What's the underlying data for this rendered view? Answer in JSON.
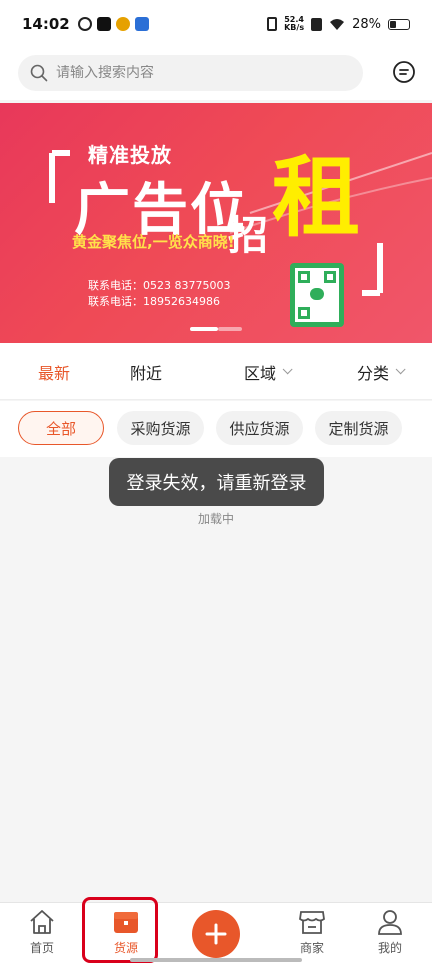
{
  "status": {
    "time": "14:02",
    "net_speed_value": "52.4",
    "net_speed_unit": "KB/s",
    "battery": "28%"
  },
  "search": {
    "placeholder": "请输入搜索内容"
  },
  "banner": {
    "subtitle": "精准投放",
    "main": "广告位",
    "zhao": "招",
    "zu": "租",
    "slogan": "黄金聚焦位,一览众商晓!",
    "phone1": "联系电话：0523 83775003",
    "phone2": "联系电话：18952634986"
  },
  "filters": [
    {
      "label": "最新",
      "active": true
    },
    {
      "label": "附近"
    },
    {
      "label": "区域"
    },
    {
      "label": "分类"
    }
  ],
  "chips": [
    {
      "label": "全部",
      "active": true
    },
    {
      "label": "采购货源"
    },
    {
      "label": "供应货源"
    },
    {
      "label": "定制货源"
    }
  ],
  "toast": "登录失效，请重新登录",
  "loading": "加载中",
  "nav": [
    {
      "label": "首页",
      "icon": "home-icon"
    },
    {
      "label": "货源",
      "icon": "box-icon",
      "active": true
    },
    {
      "label": "",
      "icon": "plus-icon"
    },
    {
      "label": "商家",
      "icon": "store-icon"
    },
    {
      "label": "我的",
      "icon": "user-icon"
    }
  ],
  "colors": {
    "accent": "#e8572a",
    "banner": "#e8385a",
    "highlight": "#d9001b"
  }
}
